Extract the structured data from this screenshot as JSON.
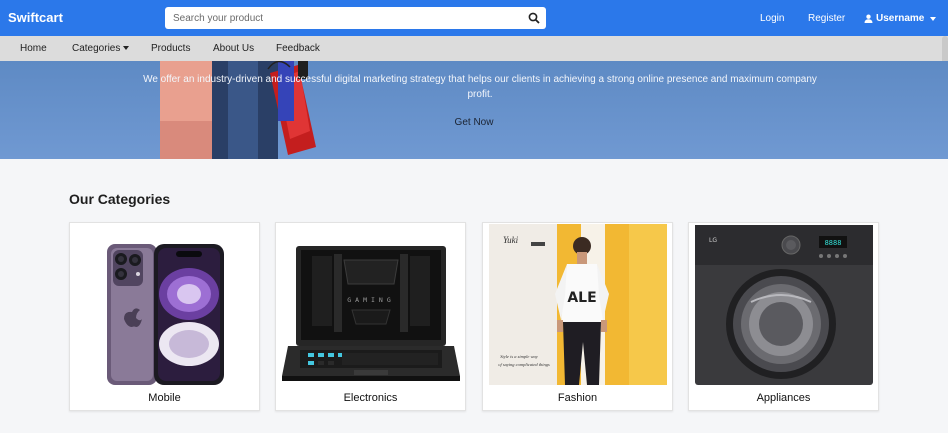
{
  "brand": "Swiftcart",
  "search": {
    "placeholder": "Search your product",
    "icon": "search-icon"
  },
  "nav_right": {
    "login": "Login",
    "register": "Register",
    "user": "Username"
  },
  "subnav": {
    "home": "Home",
    "categories": "Categories",
    "products": "Products",
    "about": "About Us",
    "feedback": "Feedback"
  },
  "hero": {
    "text": "We offer an industry-driven and successful digital marketing strategy that helps our clients in achieving a strong online presence and maximum company profit.",
    "cta": "Get Now"
  },
  "categories": {
    "title": "Our Categories",
    "items": [
      {
        "label": "Mobile"
      },
      {
        "label": "Electronics"
      },
      {
        "label": "Fashion",
        "image_text": [
          "Yuki",
          "Style is a simple way",
          "of saying complicated things"
        ],
        "shirt_text": "ALE"
      },
      {
        "label": "Appliances",
        "image_text": [
          "LG",
          "8888"
        ]
      }
    ]
  },
  "colors": {
    "navbar": "#2b78ea",
    "subnav": "#dcdcdc",
    "hero": "#6b94cf"
  }
}
